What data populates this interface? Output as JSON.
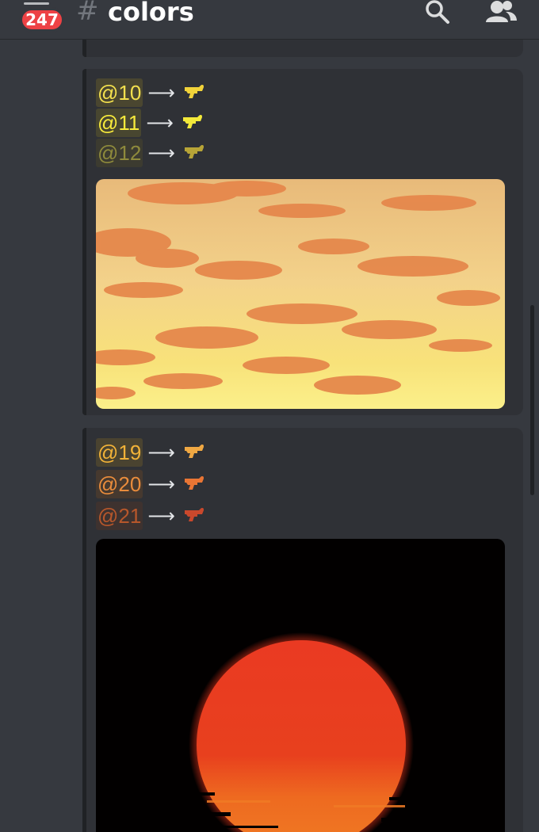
{
  "header": {
    "badge_count": "247",
    "hash_symbol": "#",
    "channel_name": "colors",
    "icons": [
      "menu-icon",
      "search-icon",
      "members-icon"
    ]
  },
  "cards": [
    {
      "roles": [
        {
          "mention": "@10",
          "arrow": "⟶",
          "color": "#f3e04e",
          "bg": "#4a4630",
          "emoji_color": "#f1d33a"
        },
        {
          "mention": "@11",
          "arrow": "⟶",
          "color": "#f7ea3c",
          "bg": "#484630",
          "emoji_color": "#f3e93a"
        },
        {
          "mention": "@12",
          "arrow": "⟶",
          "color": "#8e8a3c",
          "bg": "#3c3b30",
          "emoji_color": "#b7a437"
        }
      ],
      "image": "sunset-clouds-sky"
    },
    {
      "roles": [
        {
          "mention": "@19",
          "arrow": "⟶",
          "color": "#f1b238",
          "bg": "#4a4330",
          "emoji_color": "#f0a843"
        },
        {
          "mention": "@20",
          "arrow": "⟶",
          "color": "#e98c3c",
          "bg": "#46392f",
          "emoji_color": "#e97534"
        },
        {
          "mention": "@21",
          "arrow": "⟶",
          "color": "#b7572b",
          "bg": "#3e322f",
          "emoji_color": "#c9482c"
        }
      ],
      "image": "red-sun-over-water"
    }
  ]
}
